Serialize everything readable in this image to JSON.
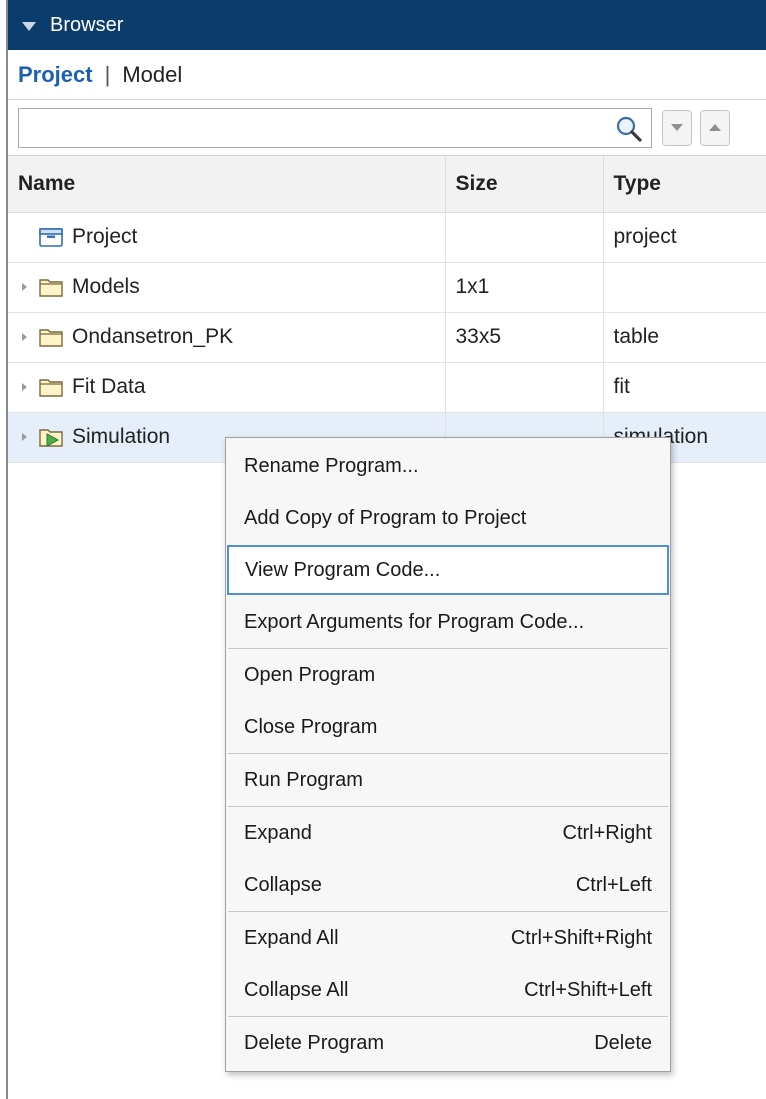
{
  "titlebar": {
    "title": "Browser"
  },
  "tabs": {
    "project": "Project",
    "separator": "|",
    "model": "Model"
  },
  "search": {
    "value": "",
    "placeholder": ""
  },
  "table": {
    "headers": {
      "name": "Name",
      "size": "Size",
      "type": "Type"
    },
    "rows": [
      {
        "name": "Project",
        "size": "",
        "type": "project",
        "icon": "project-icon",
        "expandable": false
      },
      {
        "name": "Models",
        "size": "1x1",
        "type": "",
        "icon": "folder-icon",
        "expandable": true
      },
      {
        "name": "Ondansetron_PK",
        "size": "33x5",
        "type": "table",
        "icon": "folder-icon",
        "expandable": true
      },
      {
        "name": "Fit Data",
        "size": "",
        "type": "fit",
        "icon": "folder-icon",
        "expandable": true
      },
      {
        "name": "Simulation",
        "size": "",
        "type": "simulation",
        "icon": "simulation-folder-icon",
        "expandable": true,
        "selected": true
      }
    ]
  },
  "context_menu": {
    "items": [
      {
        "label": "Rename Program...",
        "shortcut": ""
      },
      {
        "label": "Add Copy of Program to Project",
        "shortcut": ""
      },
      {
        "label": "View Program Code...",
        "shortcut": "",
        "highlighted": true
      },
      {
        "label": "Export Arguments for Program Code...",
        "shortcut": ""
      },
      {
        "label": "Open Program",
        "shortcut": ""
      },
      {
        "label": "Close Program",
        "shortcut": ""
      },
      {
        "label": "Run Program",
        "shortcut": ""
      },
      {
        "label": "Expand",
        "shortcut": "Ctrl+Right"
      },
      {
        "label": "Collapse",
        "shortcut": "Ctrl+Left"
      },
      {
        "label": "Expand All",
        "shortcut": "Ctrl+Shift+Right"
      },
      {
        "label": "Collapse All",
        "shortcut": "Ctrl+Shift+Left"
      },
      {
        "label": "Delete Program",
        "shortcut": "Delete"
      }
    ]
  },
  "colors": {
    "titlebar_bg": "#0a3d6b",
    "active_tab": "#1c5fb3",
    "selected_row": "#e5eef9",
    "menu_highlight_border": "#4d90d6"
  }
}
